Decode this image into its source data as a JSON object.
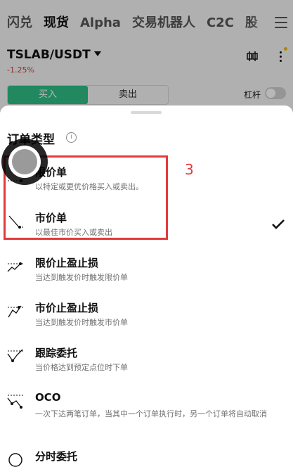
{
  "top_tabs": [
    "闪兑",
    "现货",
    "Alpha",
    "交易机器人",
    "C2C",
    "股"
  ],
  "active_tab_index": 1,
  "pair": {
    "symbol": "TSLAB/USDT",
    "change": "-1.25%"
  },
  "trade_sides": {
    "buy": "买入",
    "sell": "卖出"
  },
  "leverage": {
    "label": "杠杆",
    "enabled": false
  },
  "sheet": {
    "title": "订单类型",
    "options": [
      {
        "label": "限价单",
        "desc": "以特定或更优价格买入或卖出。",
        "icon": "limit-order-icon"
      },
      {
        "label": "市价单",
        "desc": "以最佳市价买入或卖出",
        "icon": "market-order-icon",
        "selected": true
      },
      {
        "label": "限价止盈止损",
        "desc": "当达到触发价时触发限价单",
        "icon": "limit-tpsl-icon"
      },
      {
        "label": "市价止盈止损",
        "desc": "当达到触发价时触发市价单",
        "icon": "market-tpsl-icon"
      },
      {
        "label": "跟踪委托",
        "desc": "当价格达到预定点位时下单",
        "icon": "trailing-order-icon"
      },
      {
        "label": "OCO",
        "desc": "一次下达两笔订单，当其中一个订单执行时，另一个订单将自动取消",
        "icon": "oco-icon"
      },
      {
        "label": "分时委托",
        "desc": "",
        "icon": "twap-icon"
      }
    ]
  },
  "annotation": {
    "number": "3",
    "color": "#e23b3b"
  },
  "colors": {
    "buy": "#2ebd85",
    "down": "#d23c3c",
    "accent": "#f0b90b"
  }
}
